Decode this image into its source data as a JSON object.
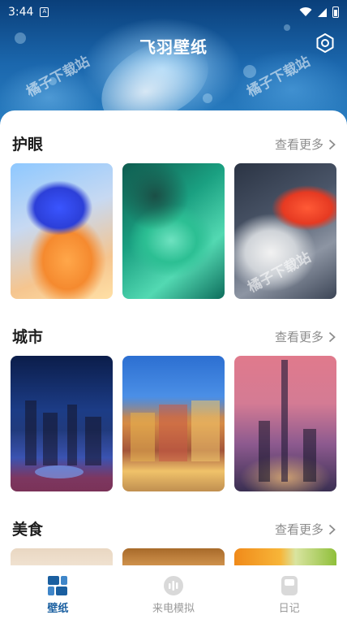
{
  "status": {
    "time": "3:44",
    "sim": "A"
  },
  "header": {
    "title": "飞羽壁纸",
    "watermark": "橘子下载站"
  },
  "sections": [
    {
      "title": "护眼",
      "more": "查看更多"
    },
    {
      "title": "城市",
      "more": "查看更多"
    },
    {
      "title": "美食",
      "more": "查看更多"
    }
  ],
  "watermark": "橘子下载站",
  "nav": [
    {
      "label": "壁纸",
      "icon": "wallpaper-grid-icon",
      "active": true
    },
    {
      "label": "来电模拟",
      "icon": "call-sim-icon",
      "active": false
    },
    {
      "label": "日记",
      "icon": "diary-icon",
      "active": false
    }
  ],
  "colors": {
    "accent": "#1a5fa0",
    "inactive": "#9a9a9a",
    "more": "#8c8c8c"
  }
}
